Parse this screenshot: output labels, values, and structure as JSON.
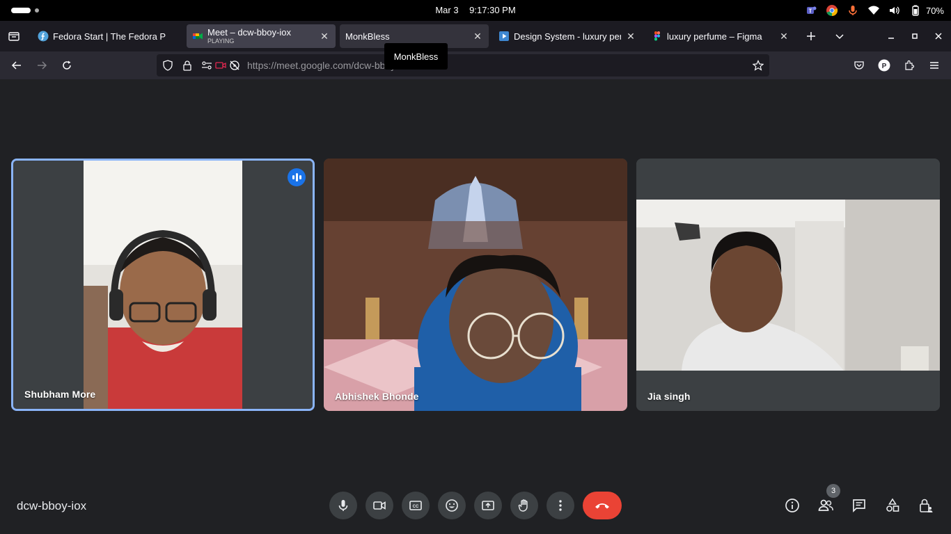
{
  "system_bar": {
    "date": "Mar 3",
    "time": "9:17:30 PM",
    "battery": "70%"
  },
  "tabs": [
    {
      "title": "Fedora Start | The Fedora P",
      "icon": "fedora-icon"
    },
    {
      "title": "Meet – dcw-bboy-iox",
      "subtitle": "PLAYING",
      "icon": "meet-icon"
    },
    {
      "title": "MonkBless",
      "icon": "none"
    },
    {
      "title": "Design System - luxury perf",
      "icon": "video-icon"
    },
    {
      "title": "luxury perfume – Figma",
      "icon": "figma-icon"
    }
  ],
  "tooltip": "MonkBless",
  "url": "https://meet.google.com/dcw-bboy-iox",
  "participants": [
    {
      "name": "Shubham More",
      "speaking": true
    },
    {
      "name": "Abhishek Bhonde",
      "speaking": false
    },
    {
      "name": "Jia singh",
      "speaking": false
    }
  ],
  "meeting_code": "dcw-bboy-iox",
  "people_count": "3",
  "colors": {
    "background": "#202124",
    "active_speaker_border": "#8ab4f8",
    "end_call": "#ea4335",
    "control_button": "#3c4043"
  }
}
